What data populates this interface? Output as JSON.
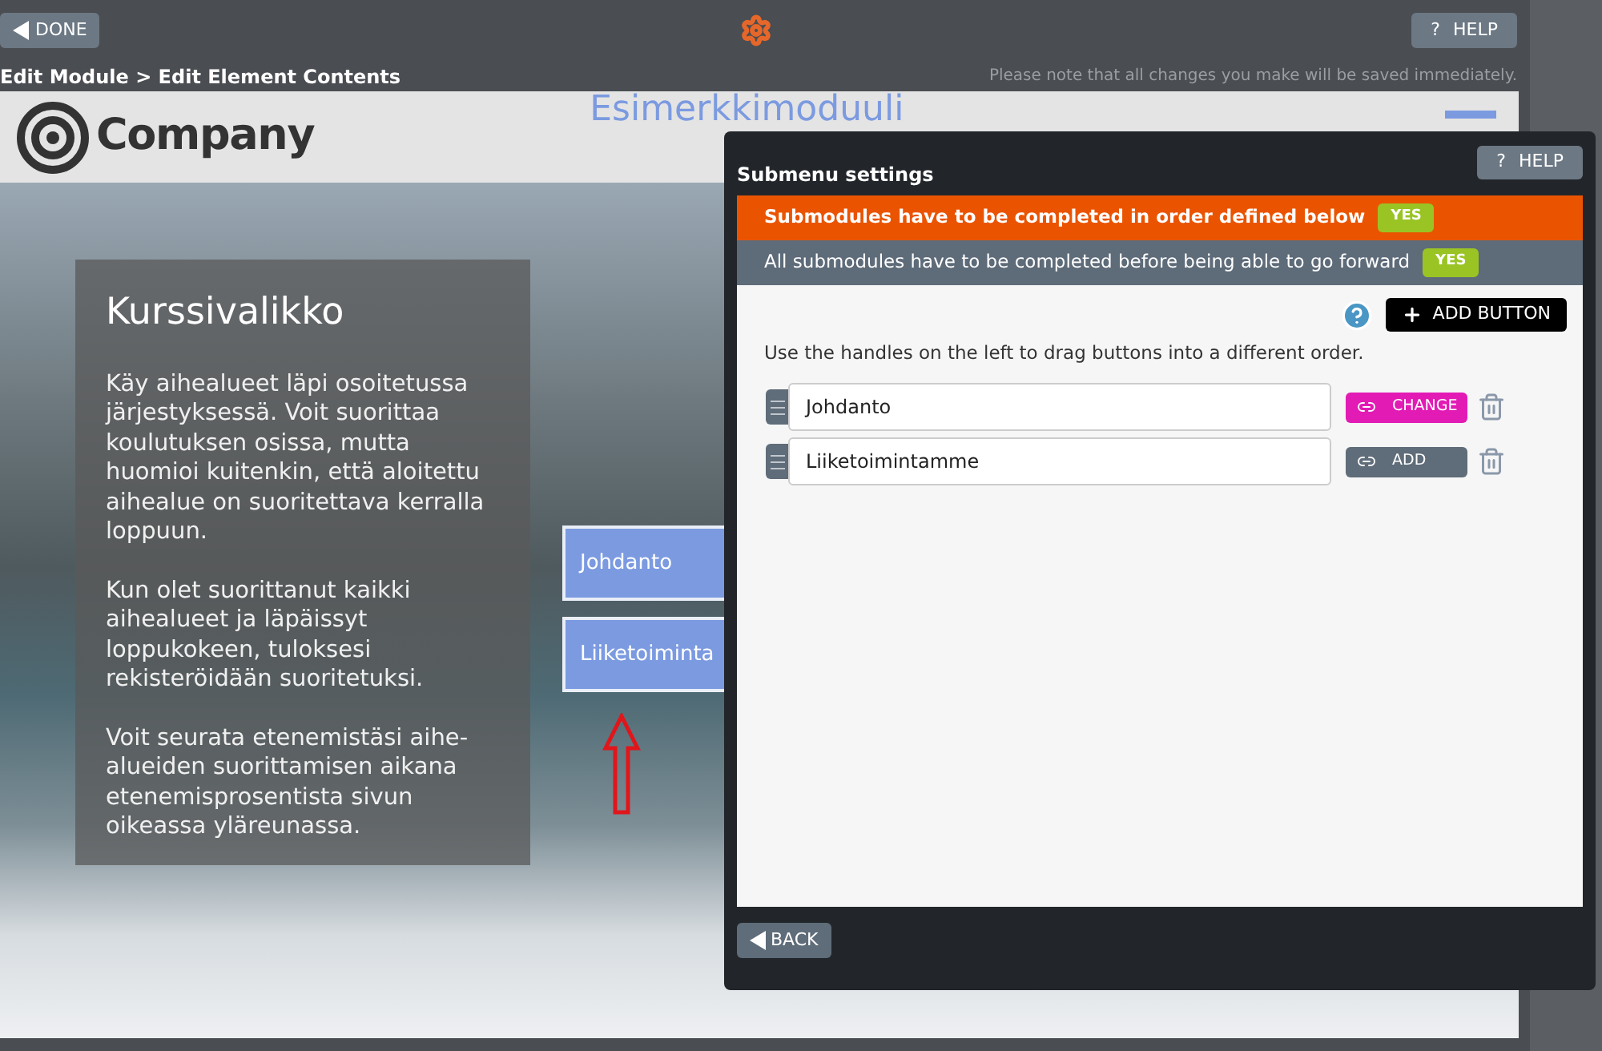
{
  "toolbar": {
    "done_button": "DONE",
    "help_button": "HELP",
    "help_mark": "?"
  },
  "breadcrumb": "Edit Module > Edit Element Contents",
  "save_notice": "Please note that all changes you make will be saved immediately.",
  "preview": {
    "logo_text": "Company",
    "module_title": "Esimerkkimoduuli",
    "panel": {
      "title": "Kurssivalikko",
      "paragraphs": [
        "Käy aihealueet läpi osoitetussa järjestyksessä. Voit suorittaa koulutuksen osissa, mutta huomioi kuitenkin, että aloitettu aihealue on suoritettava kerralla loppuun.",
        "Kun olet suorittanut kaikki aihealueet ja läpäissyt loppukokeen, tuloksesi rekisteröidään suoritetuksi.",
        "Voit seurata etenemistäsi aihe-alueiden suorittamisen aikana etenemisprosentista sivun oikeassa yläreunassa."
      ]
    },
    "menu_buttons": [
      "Johdanto",
      "Liiketoiminta"
    ]
  },
  "dialog": {
    "title": "Submenu settings",
    "help_button": "HELP",
    "help_mark": "?",
    "settings": [
      {
        "label": "Submodules have to be completed in order defined below",
        "value": "YES",
        "kind": "primary"
      },
      {
        "label": "All submodules have to be completed before being able to go forward",
        "value": "YES",
        "kind": "secondary"
      }
    ],
    "add_button": "ADD BUTTON",
    "instructions": "Use the handles on the left to drag buttons into a different order.",
    "items": [
      {
        "value": "Johdanto",
        "link": {
          "label": "CHANGE",
          "kind": "change"
        }
      },
      {
        "value": "Liiketoimintamme",
        "link": {
          "label": "ADD",
          "kind": "add"
        }
      }
    ],
    "back_button": "BACK"
  }
}
